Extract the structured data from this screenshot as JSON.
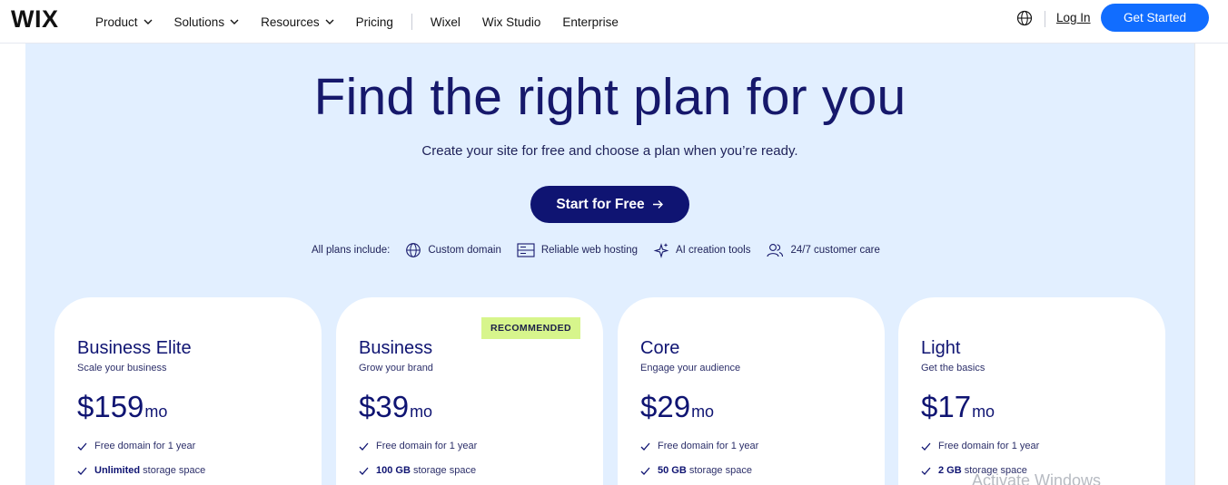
{
  "nav": {
    "logo": "WIX",
    "items": [
      {
        "label": "Product",
        "dropdown": true
      },
      {
        "label": "Solutions",
        "dropdown": true
      },
      {
        "label": "Resources",
        "dropdown": true
      },
      {
        "label": "Pricing",
        "dropdown": false
      }
    ],
    "secondary_items": [
      "Wixel",
      "Wix Studio",
      "Enterprise"
    ],
    "login": "Log In",
    "cta": "Get Started"
  },
  "hero": {
    "title": "Find the right plan for you",
    "subtitle": "Create your site for free and choose a plan when you’re ready.",
    "cta": "Start for Free",
    "includes_label": "All plans include:",
    "includes": [
      {
        "label": "Custom domain",
        "icon": "globe-icon"
      },
      {
        "label": "Reliable web hosting",
        "icon": "server-icon"
      },
      {
        "label": "AI creation tools",
        "icon": "sparkle-icon"
      },
      {
        "label": "24/7 customer care",
        "icon": "people-icon"
      }
    ]
  },
  "plans": [
    {
      "name": "Business Elite",
      "desc": "Scale your business",
      "price": "$159",
      "per": "mo",
      "badge": "",
      "features": [
        {
          "bold": "",
          "text": "Free domain for 1 year"
        },
        {
          "bold": "Unlimited",
          "text": " storage space"
        }
      ]
    },
    {
      "name": "Business",
      "desc": "Grow your brand",
      "price": "$39",
      "per": "mo",
      "badge": "RECOMMENDED",
      "features": [
        {
          "bold": "",
          "text": "Free domain for 1 year"
        },
        {
          "bold": "100 GB",
          "text": " storage space"
        }
      ]
    },
    {
      "name": "Core",
      "desc": "Engage your audience",
      "price": "$29",
      "per": "mo",
      "badge": "",
      "features": [
        {
          "bold": "",
          "text": "Free domain for 1 year"
        },
        {
          "bold": "50 GB",
          "text": " storage space"
        }
      ]
    },
    {
      "name": "Light",
      "desc": "Get the basics",
      "price": "$17",
      "per": "mo",
      "badge": "",
      "features": [
        {
          "bold": "",
          "text": "Free domain for 1 year"
        },
        {
          "bold": "2 GB",
          "text": " storage space"
        }
      ]
    }
  ],
  "watermark": "Activate Windows",
  "colors": {
    "accent": "#116dff",
    "navy": "#0f1472",
    "hero_bg": "#e2efff",
    "badge": "#d7f58c"
  }
}
